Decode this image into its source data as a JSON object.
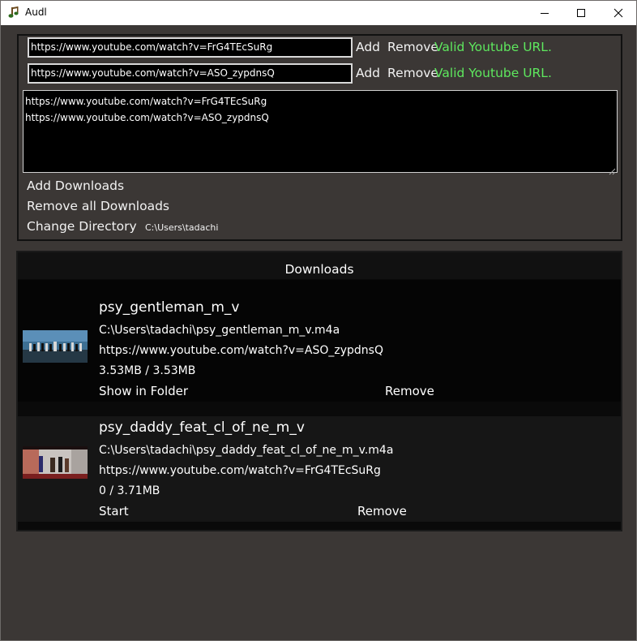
{
  "window": {
    "title": "Audl",
    "icon": "music-note-icon",
    "controls": [
      "minimize-icon",
      "maximize-icon",
      "close-icon"
    ]
  },
  "url_inputs": [
    {
      "value": "https://www.youtube.com/watch?v=FrG4TEcSuRg",
      "add_label": "Add",
      "remove_label": "Remove",
      "status": "Valid Youtube URL."
    },
    {
      "value": "https://www.youtube.com/watch?v=ASO_zypdnsQ",
      "add_label": "Add",
      "remove_label": "Remove",
      "status": "Valid Youtube URL."
    }
  ],
  "url_list": [
    "https://www.youtube.com/watch?v=FrG4TEcSuRg",
    "https://www.youtube.com/watch?v=ASO_zypdnsQ"
  ],
  "actions": {
    "add_downloads": "Add Downloads",
    "remove_all": "Remove all Downloads",
    "change_directory": "Change Directory",
    "directory_path": "C:\\Users\\tadachi"
  },
  "downloads": {
    "header": "Downloads",
    "items": [
      {
        "title": "psy_gentleman_m_v",
        "path": "C:\\Users\\tadachi\\psy_gentleman_m_v.m4a",
        "url": "https://www.youtube.com/watch?v=ASO_zypdnsQ",
        "progress": "3.53MB / 3.53MB",
        "primary_action": "Show in Folder",
        "remove_label": "Remove"
      },
      {
        "title": "psy_daddy_feat_cl_of_ne_m_v",
        "path": "C:\\Users\\tadachi\\psy_daddy_feat_cl_of_ne_m_v.m4a",
        "url": "https://www.youtube.com/watch?v=FrG4TEcSuRg",
        "progress": "0 / 3.71MB",
        "primary_action": "Start",
        "remove_label": "Remove"
      }
    ]
  },
  "colors": {
    "background": "#3b3735",
    "status_valid": "#5ee85e",
    "input_bg": "#000000"
  }
}
